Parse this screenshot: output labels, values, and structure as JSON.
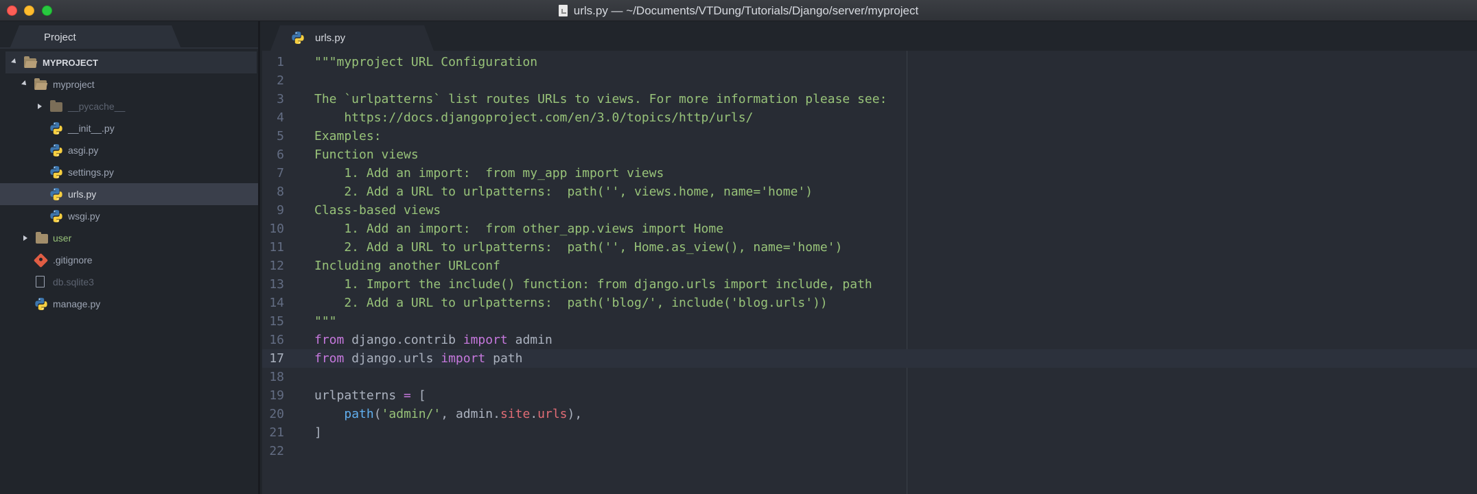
{
  "window": {
    "title": "urls.py — ~/Documents/VTDung/Tutorials/Django/server/myproject"
  },
  "sidebar": {
    "tab_label": "Project",
    "tree": [
      {
        "label": "MYPROJECT",
        "kind": "root",
        "icon": "folder-open-icon"
      },
      {
        "label": "myproject",
        "kind": "folder-open",
        "icon": "folder-open-icon"
      },
      {
        "label": "__pycache__",
        "kind": "folder-closed-dim",
        "icon": "folder-icon"
      },
      {
        "label": "__init__.py",
        "kind": "py",
        "icon": "python-icon"
      },
      {
        "label": "asgi.py",
        "kind": "py",
        "icon": "python-icon"
      },
      {
        "label": "settings.py",
        "kind": "py",
        "icon": "python-icon"
      },
      {
        "label": "urls.py",
        "kind": "py-selected",
        "icon": "python-icon"
      },
      {
        "label": "wsgi.py",
        "kind": "py",
        "icon": "python-icon"
      },
      {
        "label": "user",
        "kind": "folder-closed-green",
        "icon": "folder-icon"
      },
      {
        "label": ".gitignore",
        "kind": "git",
        "icon": "git-icon"
      },
      {
        "label": "db.sqlite3",
        "kind": "file-dim",
        "icon": "file-icon"
      },
      {
        "label": "manage.py",
        "kind": "py",
        "icon": "python-icon"
      }
    ]
  },
  "editor": {
    "tab": {
      "label": "urls.py",
      "close_glyph": "×"
    },
    "cursor_line": 17,
    "lines": [
      {
        "n": "1",
        "tokens": [
          {
            "t": "\"\"\"myproject URL Configuration",
            "c": "str"
          }
        ]
      },
      {
        "n": "2",
        "tokens": []
      },
      {
        "n": "3",
        "tokens": [
          {
            "t": "The `urlpatterns` list routes URLs to views. For more information please see:",
            "c": "str"
          }
        ]
      },
      {
        "n": "4",
        "tokens": [
          {
            "t": "    https://docs.djangoproject.com/en/3.0/topics/http/urls/",
            "c": "str"
          }
        ]
      },
      {
        "n": "5",
        "tokens": [
          {
            "t": "Examples:",
            "c": "str"
          }
        ]
      },
      {
        "n": "6",
        "tokens": [
          {
            "t": "Function views",
            "c": "str"
          }
        ]
      },
      {
        "n": "7",
        "tokens": [
          {
            "t": "    1. Add an import:  from my_app import views",
            "c": "str"
          }
        ]
      },
      {
        "n": "8",
        "tokens": [
          {
            "t": "    2. Add a URL to urlpatterns:  path('', views.home, name='home')",
            "c": "str"
          }
        ]
      },
      {
        "n": "9",
        "tokens": [
          {
            "t": "Class-based views",
            "c": "str"
          }
        ]
      },
      {
        "n": "10",
        "tokens": [
          {
            "t": "    1. Add an import:  from other_app.views import Home",
            "c": "str"
          }
        ]
      },
      {
        "n": "11",
        "tokens": [
          {
            "t": "    2. Add a URL to urlpatterns:  path('', Home.as_view(), name='home')",
            "c": "str"
          }
        ]
      },
      {
        "n": "12",
        "tokens": [
          {
            "t": "Including another URLconf",
            "c": "str"
          }
        ]
      },
      {
        "n": "13",
        "tokens": [
          {
            "t": "    1. Import the include() function: from django.urls import include, path",
            "c": "str"
          }
        ]
      },
      {
        "n": "14",
        "tokens": [
          {
            "t": "    2. Add a URL to urlpatterns:  path('blog/', include('blog.urls'))",
            "c": "str"
          }
        ]
      },
      {
        "n": "15",
        "tokens": [
          {
            "t": "\"\"\"",
            "c": "str"
          }
        ]
      },
      {
        "n": "16",
        "tokens": [
          {
            "t": "from",
            "c": "kw"
          },
          {
            "t": " django.contrib ",
            "c": "plain"
          },
          {
            "t": "import",
            "c": "kw"
          },
          {
            "t": " admin",
            "c": "plain"
          }
        ]
      },
      {
        "n": "17",
        "tokens": [
          {
            "t": "from",
            "c": "kw"
          },
          {
            "t": " django.urls ",
            "c": "plain"
          },
          {
            "t": "import",
            "c": "kw"
          },
          {
            "t": " path",
            "c": "plain"
          }
        ]
      },
      {
        "n": "18",
        "tokens": []
      },
      {
        "n": "19",
        "tokens": [
          {
            "t": "urlpatterns ",
            "c": "plain"
          },
          {
            "t": "=",
            "c": "op"
          },
          {
            "t": " [",
            "c": "plain"
          }
        ]
      },
      {
        "n": "20",
        "tokens": [
          {
            "t": "    ",
            "c": "plain"
          },
          {
            "t": "path",
            "c": "fn"
          },
          {
            "t": "(",
            "c": "plain"
          },
          {
            "t": "'admin/'",
            "c": "str"
          },
          {
            "t": ", admin.",
            "c": "plain"
          },
          {
            "t": "site",
            "c": "attr"
          },
          {
            "t": ".",
            "c": "plain"
          },
          {
            "t": "urls",
            "c": "attr"
          },
          {
            "t": "),",
            "c": "plain"
          }
        ]
      },
      {
        "n": "21",
        "tokens": [
          {
            "t": "]",
            "c": "plain"
          }
        ]
      },
      {
        "n": "22",
        "tokens": []
      }
    ]
  },
  "colors": {
    "string": "#98c379",
    "keyword": "#c678dd",
    "function": "#61afef",
    "attribute": "#e06c75",
    "plain": "#abb2bf"
  }
}
